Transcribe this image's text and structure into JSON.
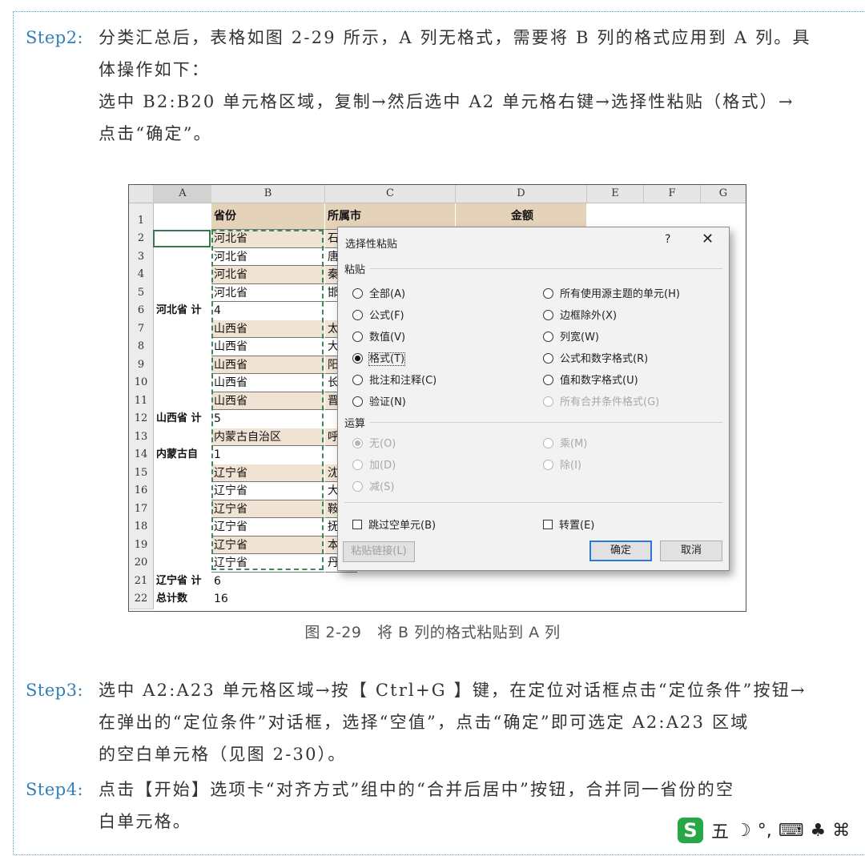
{
  "steps": [
    {
      "label": "Step2:",
      "lines": [
        "分类汇总后，表格如图 2-29 所示，A 列无格式，需要将 B 列的格式应用到 A 列。具",
        "体操作如下：",
        "选中 B2:B20 单元格区域，复制→然后选中 A2 单元格右键→选择性粘贴（格式）→",
        "点击“确定”。"
      ]
    },
    {
      "label": "Step3:",
      "lines": [
        "选中 A2:A23 单元格区域→按【 Ctrl+G 】键，在定位对话框点击“定位条件”按钮→",
        "在弹出的“定位条件”对话框，选择“空值”，点击“确定”即可选定 A2:A23 区域",
        "的空白单元格（见图 2-30）。"
      ]
    },
    {
      "label": "Step4:",
      "lines": [
        "点击【开始】选项卡“对齐方式”组中的“合并后居中”按钮，合并同一省份的空",
        "白单元格。"
      ]
    }
  ],
  "sheet": {
    "columns": [
      "A",
      "B",
      "C",
      "D",
      "E",
      "F",
      "G"
    ],
    "header_row": {
      "B": "省份",
      "C": "所属市",
      "D": "金额"
    },
    "rows": [
      {
        "n": "1"
      },
      {
        "n": "2",
        "A": "",
        "B": "河北省",
        "C": "石"
      },
      {
        "n": "3",
        "B": "河北省",
        "C": "唐"
      },
      {
        "n": "4",
        "B": "河北省",
        "C": "秦"
      },
      {
        "n": "5",
        "B": "河北省",
        "C": "邯"
      },
      {
        "n": "6",
        "A": "河北省 计",
        "B": "4"
      },
      {
        "n": "7",
        "B": "山西省",
        "C": "太"
      },
      {
        "n": "8",
        "B": "山西省",
        "C": "大"
      },
      {
        "n": "9",
        "B": "山西省",
        "C": "阳"
      },
      {
        "n": "10",
        "B": "山西省",
        "C": "长"
      },
      {
        "n": "11",
        "B": "山西省",
        "C": "晋"
      },
      {
        "n": "12",
        "A": "山西省 计",
        "B": "5"
      },
      {
        "n": "13",
        "B": "内蒙古自治区",
        "C": "呼"
      },
      {
        "n": "14",
        "A": "内蒙古自",
        "B": "1"
      },
      {
        "n": "15",
        "B": "辽宁省",
        "C": "沈"
      },
      {
        "n": "16",
        "B": "辽宁省",
        "C": "大"
      },
      {
        "n": "17",
        "B": "辽宁省",
        "C": "鞍"
      },
      {
        "n": "18",
        "B": "辽宁省",
        "C": "抚"
      },
      {
        "n": "19",
        "B": "辽宁省",
        "C": "本"
      },
      {
        "n": "20",
        "B": "辽宁省",
        "C": "丹"
      },
      {
        "n": "21",
        "A": "辽宁省 计",
        "B": "6"
      },
      {
        "n": "22",
        "A": "总计数",
        "B": "16"
      }
    ]
  },
  "dialog": {
    "title": "选择性粘贴",
    "help": "?",
    "close": "✕",
    "paste_section": "粘贴",
    "paste_left": [
      "全部(A)",
      "公式(F)",
      "数值(V)",
      "格式(T)",
      "批注和注释(C)",
      "验证(N)"
    ],
    "paste_right": [
      "所有使用源主题的单元(H)",
      "边框除外(X)",
      "列宽(W)",
      "公式和数字格式(R)",
      "值和数字格式(U)",
      "所有合并条件格式(G)"
    ],
    "selected": "格式(T)",
    "op_section": "运算",
    "op_left": [
      "无(O)",
      "加(D)",
      "减(S)"
    ],
    "op_right": [
      "乘(M)",
      "除(I)"
    ],
    "skip_blanks": "跳过空单元(B)",
    "transpose": "转置(E)",
    "paste_link": "粘贴链接(L)",
    "ok": "确定",
    "cancel": "取消"
  },
  "caption": "图 2-29　将 B 列的格式粘贴到 A 列",
  "ime": {
    "logo": "S",
    "glyphs": [
      "五",
      "☽",
      "°,",
      "⌨",
      "♣",
      "⌘"
    ]
  }
}
